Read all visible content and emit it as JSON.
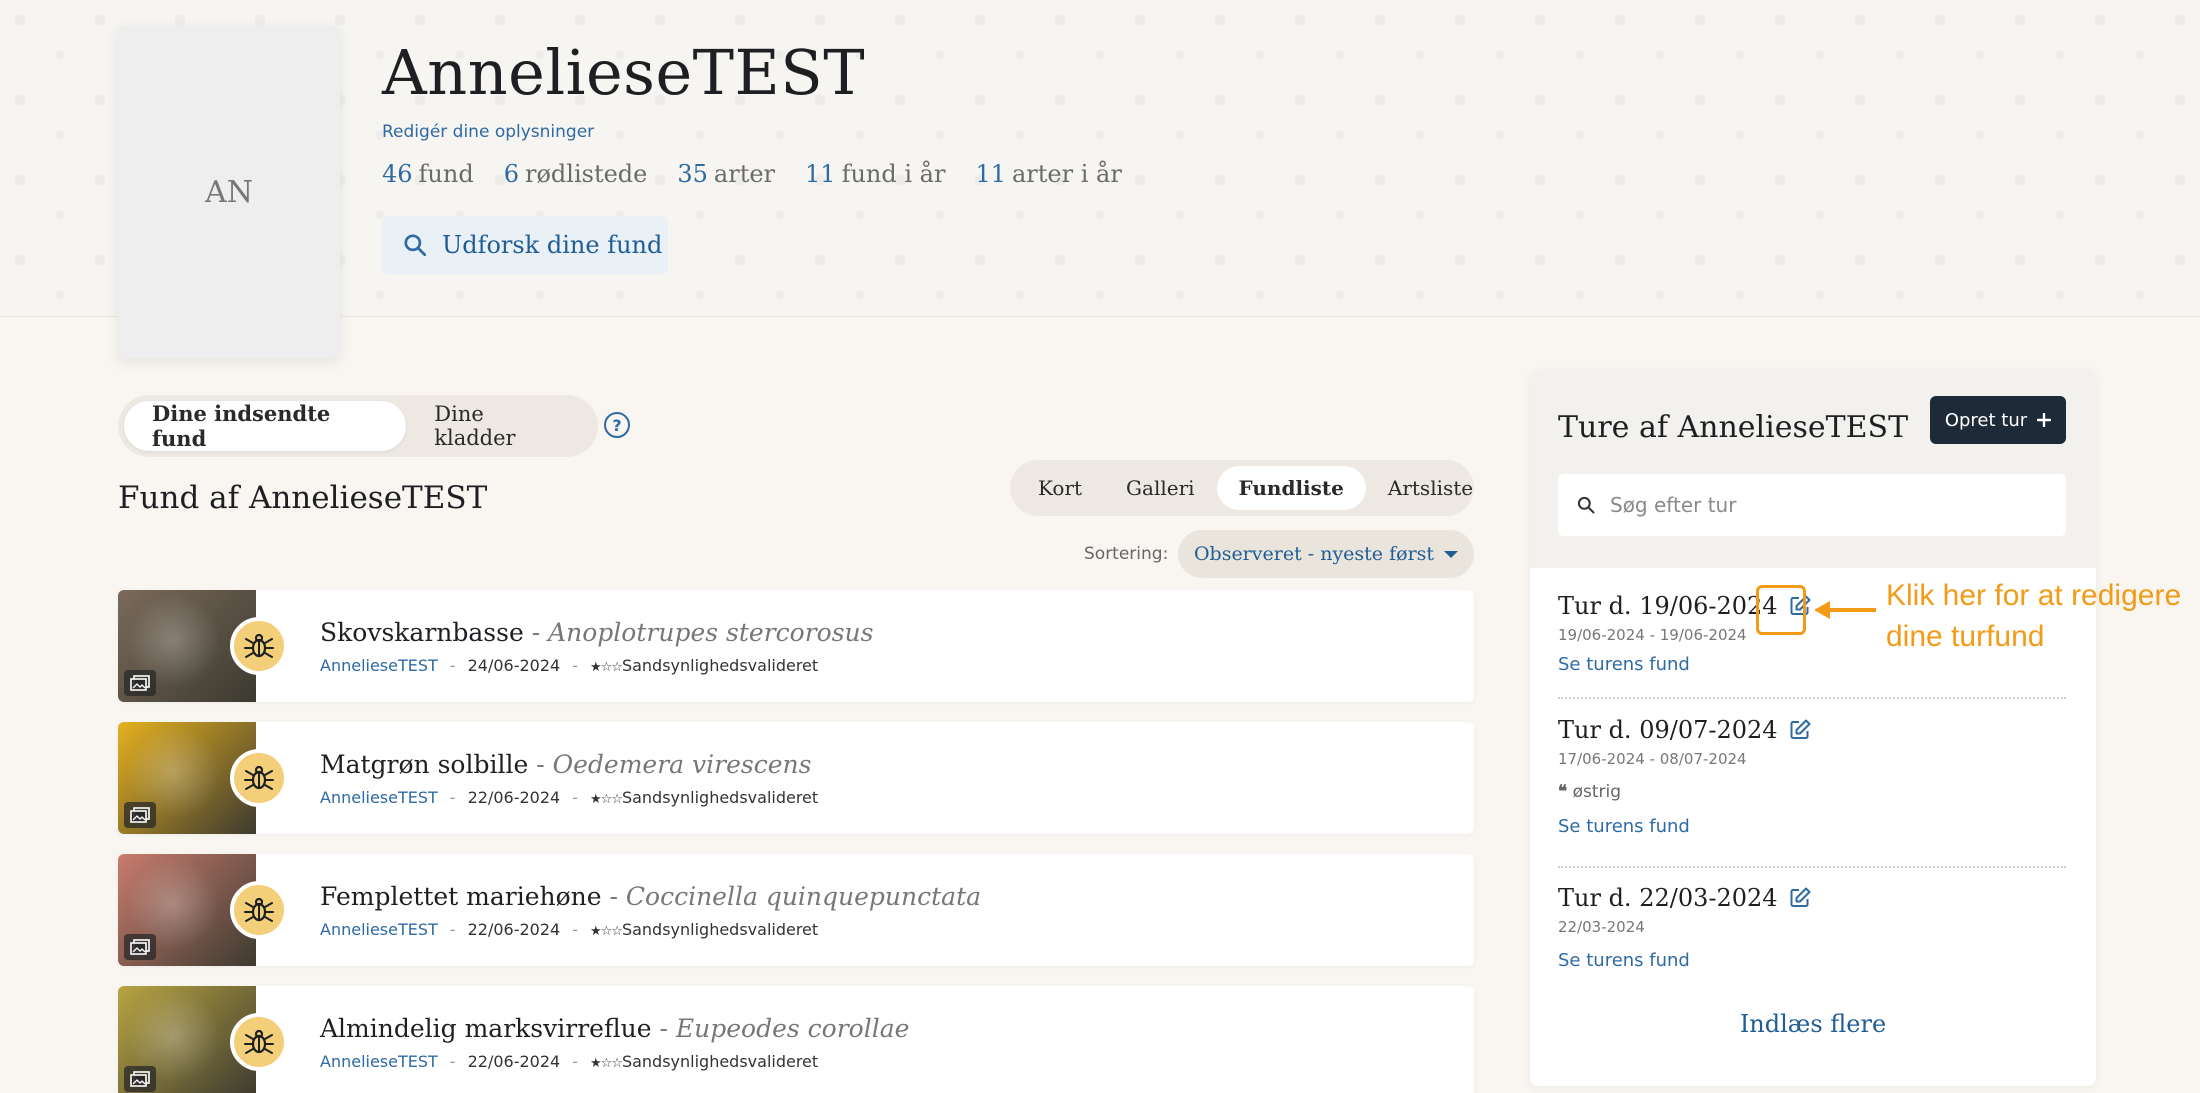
{
  "profile": {
    "initials": "AN",
    "username": "AnnelieseTEST",
    "edit_link": "Redigér dine oplysninger",
    "stats": [
      {
        "num": "46",
        "label": "fund"
      },
      {
        "num": "6",
        "label": "rødlistede"
      },
      {
        "num": "35",
        "label": "arter"
      },
      {
        "num": "11",
        "label": "fund i år"
      },
      {
        "num": "11",
        "label": "arter i år"
      }
    ],
    "explore_button": "Udforsk dine fund"
  },
  "tabs": {
    "submitted": "Dine indsendte fund",
    "drafts": "Dine kladder",
    "help": "?"
  },
  "finds_title": "Fund af AnnelieseTEST",
  "view_tabs": [
    "Kort",
    "Galleri",
    "Fundliste",
    "Artsliste"
  ],
  "active_view": "Fundliste",
  "sorting": {
    "label": "Sortering:",
    "value": "Observeret - nyeste først"
  },
  "finds": [
    {
      "name": "Skovskarnbasse",
      "sep": " - ",
      "latin": "Anoplotrupes stercorosus",
      "user": "AnnelieseTEST",
      "date": "24/06-2024",
      "stars": "★☆☆",
      "status": "Sandsynlighedsvalideret",
      "thumb_color": "#7a6a5a"
    },
    {
      "name": "Matgrøn solbille",
      "sep": " - ",
      "latin": "Oedemera virescens",
      "user": "AnnelieseTEST",
      "date": "22/06-2024",
      "stars": "★☆☆",
      "status": "Sandsynlighedsvalideret",
      "thumb_color": "#e6b11f"
    },
    {
      "name": "Femplettet mariehøne",
      "sep": " - ",
      "latin": "Coccinella quinquepunctata",
      "user": "AnnelieseTEST",
      "date": "22/06-2024",
      "stars": "★☆☆",
      "status": "Sandsynlighedsvalideret",
      "thumb_color": "#c97c6e"
    },
    {
      "name": "Almindelig marksvirreflue",
      "sep": " - ",
      "latin": "Eupeodes corollae",
      "user": "AnnelieseTEST",
      "date": "22/06-2024",
      "stars": "★☆☆",
      "status": "Sandsynlighedsvalideret",
      "thumb_color": "#b9a542"
    }
  ],
  "trips_panel": {
    "title": "Ture af AnnelieseTEST",
    "create_button": "Opret tur",
    "search_placeholder": "Søg efter tur",
    "trips": [
      {
        "title": "Tur d. 19/06-2024",
        "dates": "19/06-2024  -  19/06-2024",
        "place": "",
        "link": "Se turens fund"
      },
      {
        "title": "Tur d. 09/07-2024",
        "dates": "17/06-2024  -  08/07-2024",
        "place": "østrig",
        "link": "Se turens fund"
      },
      {
        "title": "Tur d. 22/03-2024",
        "dates": "22/03-2024",
        "place": "",
        "link": "Se turens fund"
      }
    ],
    "load_more": "Indlæs flere"
  },
  "annotation": {
    "line1": "Klik her for at redigere",
    "line2": "dine turfund",
    "color": "#f39a17"
  }
}
